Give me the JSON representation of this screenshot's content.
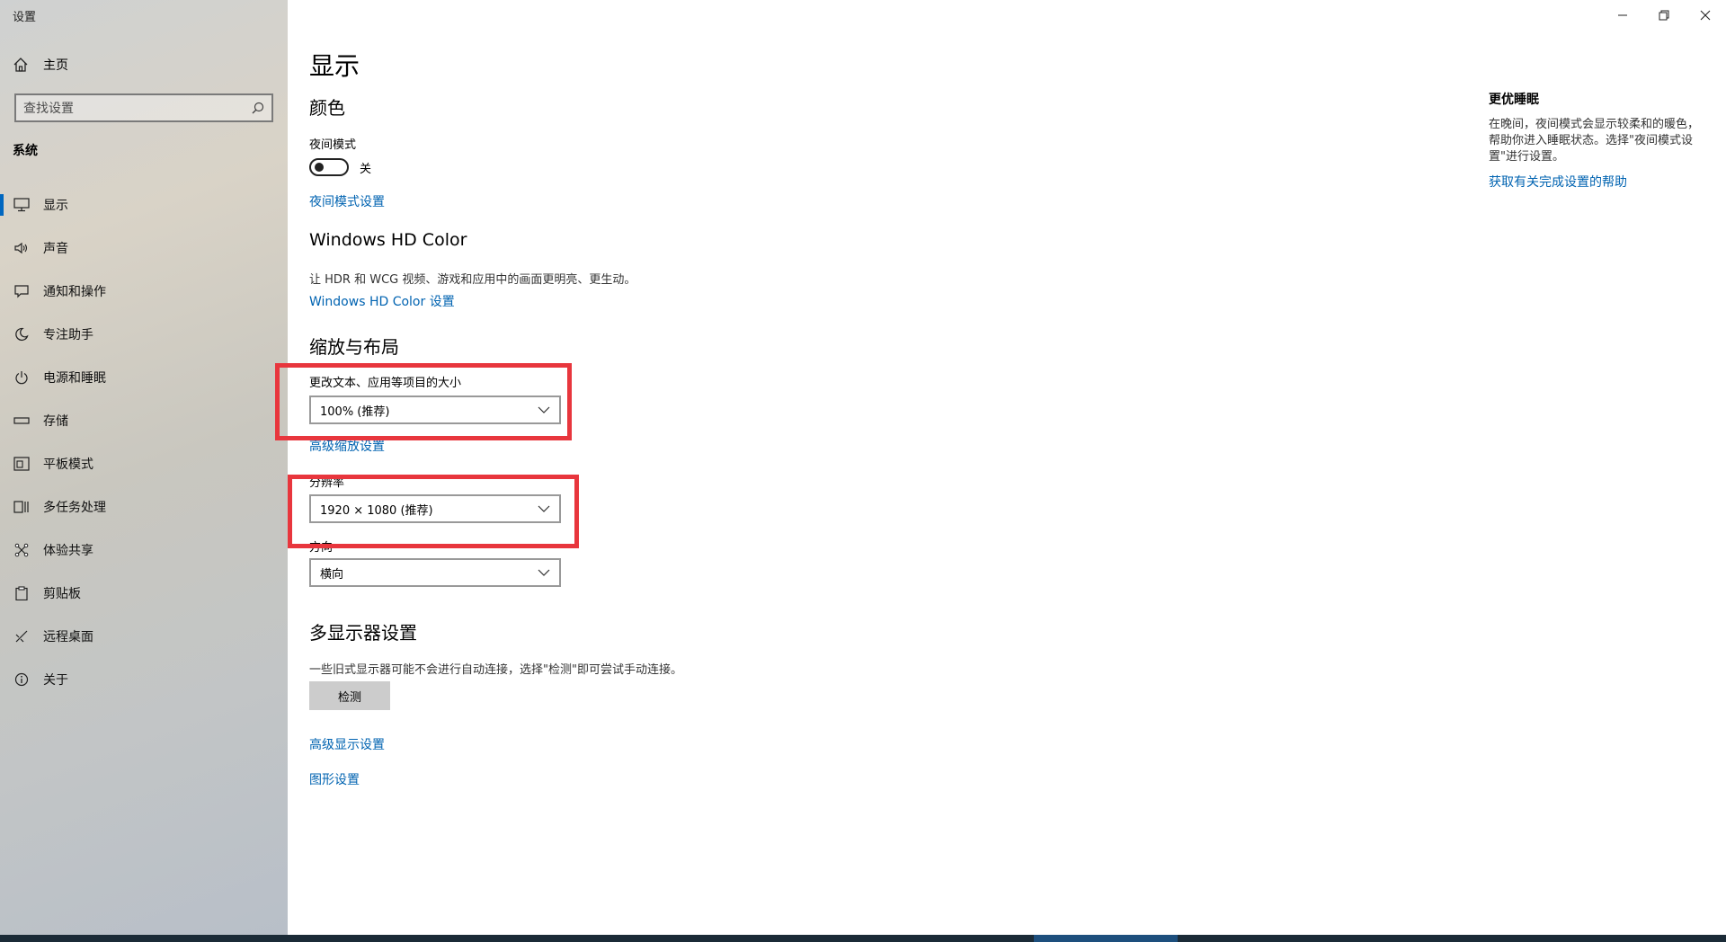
{
  "window": {
    "title": "设置"
  },
  "sidebar": {
    "home": "主页",
    "search_placeholder": "查找设置",
    "category": "系统",
    "items": [
      {
        "label": "显示",
        "icon": "monitor-icon",
        "active": true
      },
      {
        "label": "声音",
        "icon": "speaker-icon"
      },
      {
        "label": "通知和操作",
        "icon": "notification-icon"
      },
      {
        "label": "专注助手",
        "icon": "moon-icon"
      },
      {
        "label": "电源和睡眠",
        "icon": "power-icon"
      },
      {
        "label": "存储",
        "icon": "storage-icon"
      },
      {
        "label": "平板模式",
        "icon": "tablet-icon"
      },
      {
        "label": "多任务处理",
        "icon": "multitask-icon"
      },
      {
        "label": "体验共享",
        "icon": "share-icon"
      },
      {
        "label": "剪贴板",
        "icon": "clipboard-icon"
      },
      {
        "label": "远程桌面",
        "icon": "remote-icon"
      },
      {
        "label": "关于",
        "icon": "info-icon"
      }
    ]
  },
  "main": {
    "title": "显示",
    "color_heading": "颜色",
    "night_mode_label": "夜间模式",
    "night_mode_state": "关",
    "night_mode_link": "夜间模式设置",
    "hdr_heading": "Windows HD Color",
    "hdr_desc": "让 HDR 和 WCG 视频、游戏和应用中的画面更明亮、更生动。",
    "hdr_link": "Windows HD Color 设置",
    "scale_heading": "缩放与布局",
    "scale_label": "更改文本、应用等项目的大小",
    "scale_value": "100% (推荐)",
    "advanced_scale_link": "高级缩放设置",
    "resolution_label": "分辨率",
    "resolution_value": "1920 × 1080 (推荐)",
    "orientation_label": "方向",
    "orientation_value": "横向",
    "multi_heading": "多显示器设置",
    "multi_desc": "一些旧式显示器可能不会进行自动连接，选择\"检测\"即可尝试手动连接。",
    "detect_button": "检测",
    "advanced_display_link": "高级显示设置",
    "graphics_link": "图形设置"
  },
  "right_panel": {
    "title": "更优睡眠",
    "text": "在晚间，夜间模式会显示较柔和的暖色，帮助你进入睡眠状态。选择\"夜间模式设置\"进行设置。",
    "link": "获取有关完成设置的帮助"
  },
  "colors": {
    "accent": "#0063b1",
    "highlight": "#e8363d"
  }
}
